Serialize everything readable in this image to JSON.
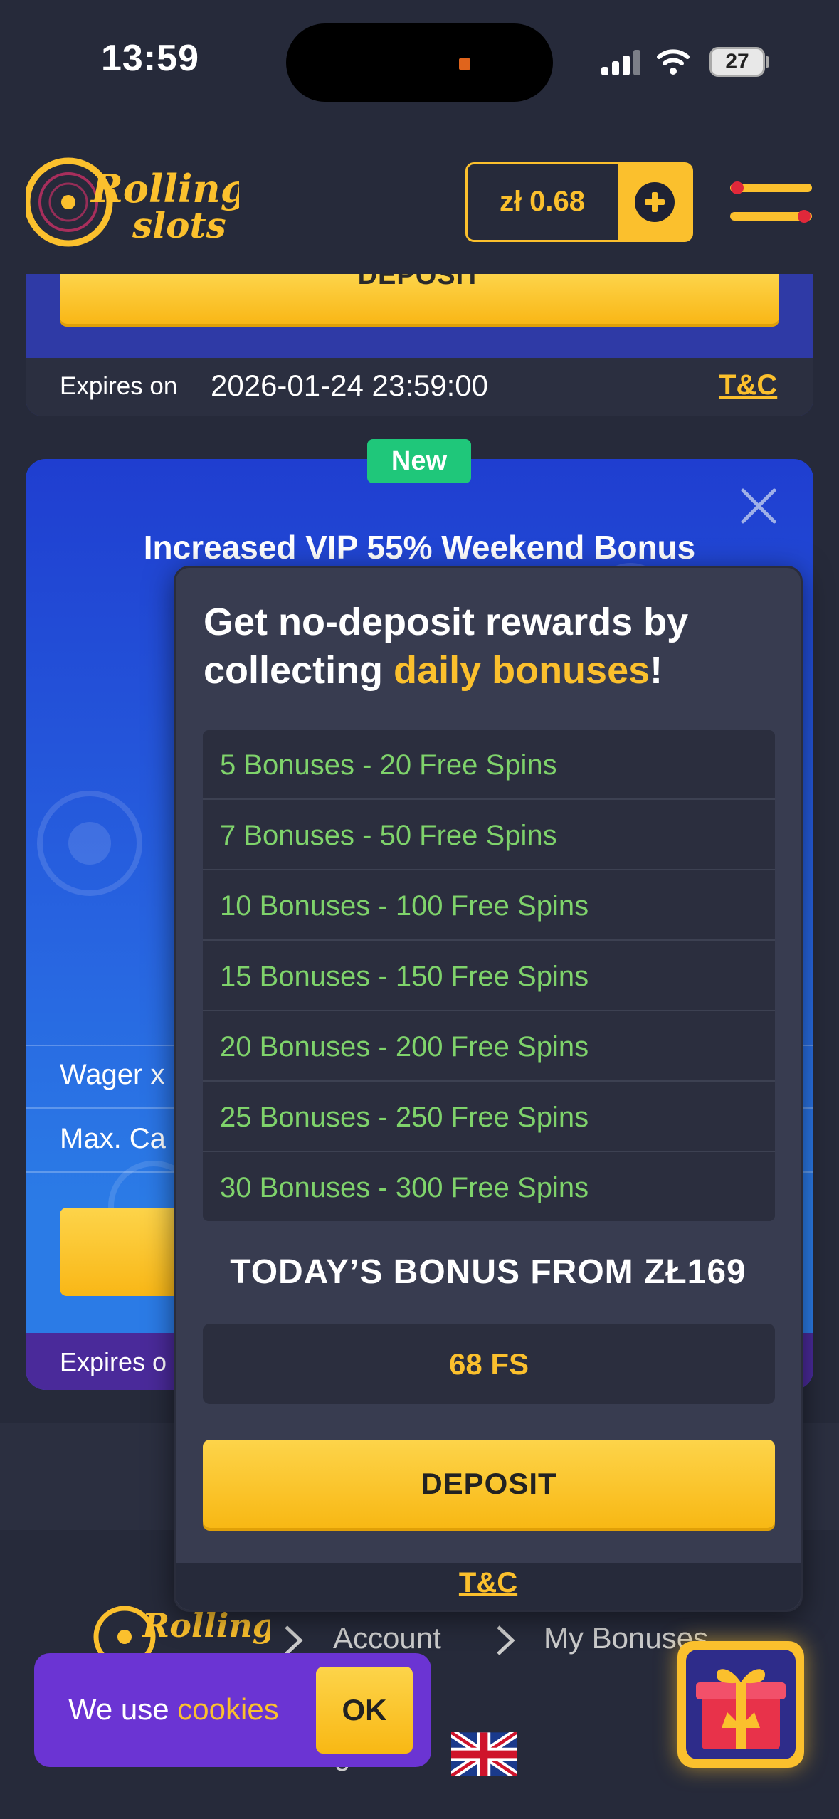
{
  "status_bar": {
    "time": "13:59",
    "battery": "27"
  },
  "header": {
    "balance": "zł 0.68",
    "logo_text": "Rolling slots"
  },
  "card1": {
    "button_label": "DEPOSIT",
    "expires_label": "Expires on",
    "expires_date": "2026-01-24 23:59:00",
    "tc_label": "T&C"
  },
  "card2": {
    "badge": "New",
    "title": "Increased VIP 55% Weekend Bonus",
    "wager_partial": "Wager x",
    "max_cashout_partial": "Max. Ca",
    "expires_partial": "Expires o"
  },
  "modal": {
    "title_part1": "Get no-deposit rewards by collecting ",
    "title_highlight": "daily bonuses",
    "title_end": "!",
    "rewards": [
      "5 Bonuses - 20 Free Spins",
      "7 Bonuses - 50 Free Spins",
      "10 Bonuses - 100 Free Spins",
      "15 Bonuses - 150 Free Spins",
      "20 Bonuses - 200 Free Spins",
      "25 Bonuses - 250 Free Spins",
      "30 Bonuses - 300 Free Spins"
    ],
    "today_label": "TODAY’S BONUS FROM ZŁ169",
    "today_value": "68 FS",
    "deposit_label": "DEPOSIT",
    "tc_label": "T&C"
  },
  "breadcrumb": {
    "account": "Account",
    "bonuses": "My Bonuses"
  },
  "language": {
    "partial": "glish"
  },
  "cookie": {
    "prefix": "We use ",
    "link": "cookies",
    "ok": "OK"
  },
  "colors": {
    "accent": "#fbc02d",
    "green": "#7fd36b",
    "badge": "#1fc77a",
    "bg": "#262a3a",
    "cookie_bg": "#6b34d3"
  }
}
